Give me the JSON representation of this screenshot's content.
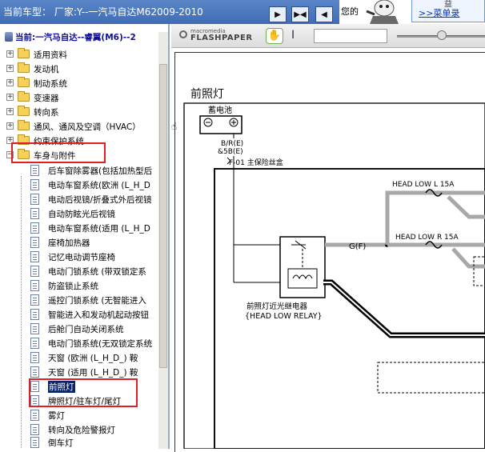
{
  "header": {
    "title": "当前车型：  厂家:Y--一汽马自达M62009-2010",
    "nav_buttons": [
      "▶",
      "▶◀",
      "◀"
    ]
  },
  "ad": {
    "message": "您的",
    "bubble_top": "益",
    "link": ">>菜单录"
  },
  "tree": {
    "current": "当前:一汽马自达--睿翼(M6)--2",
    "folders": [
      {
        "label": "适用资料"
      },
      {
        "label": "发动机"
      },
      {
        "label": "制动系统"
      },
      {
        "label": "变速器"
      },
      {
        "label": "转向系"
      },
      {
        "label": "通风、通风及空调（HVAC）"
      },
      {
        "label": "约束保护系统"
      },
      {
        "label": "车身与附件"
      }
    ],
    "leaves": [
      {
        "label": "后车窗除雾器(包括加热型后"
      },
      {
        "label": "电动车窗系统(欧洲 (L_H_D"
      },
      {
        "label": "电动后视镜/折叠式外后视镜"
      },
      {
        "label": "自动防眩光后视镜"
      },
      {
        "label": "电动车窗系统(适用 (L_H_D"
      },
      {
        "label": "座椅加热器"
      },
      {
        "label": "记忆电动调节座椅"
      },
      {
        "label": "电动门锁系统 (带双锁定系"
      },
      {
        "label": "防盗锁止系统"
      },
      {
        "label": "遥控门锁系统 (无智能进入"
      },
      {
        "label": "智能进入和发动机起动按钮"
      },
      {
        "label": "后舱门自动关闭系统"
      },
      {
        "label": "电动门锁系统(无双锁定系统"
      },
      {
        "label": "天窗    (欧洲 (L_H_D_) 鞍"
      },
      {
        "label": "天窗    (适用 (L_H_D_) 鞍"
      },
      {
        "label": "前照灯"
      },
      {
        "label": "牌照灯/驻车灯/尾灯"
      },
      {
        "label": "雾灯"
      },
      {
        "label": "转向及危险警报灯"
      },
      {
        "label": "倒车灯"
      }
    ]
  },
  "viewer": {
    "logo_small": "macromedia",
    "logo_big": "FLASHPAPER",
    "hand_tool": "hand-tool",
    "select_tool": "I"
  },
  "diagram": {
    "title": "前照灯",
    "battery": "蓄电池",
    "wire1": "B/R(E)",
    "wire2": "&5B(E)",
    "fuse": "F-01 主保险丝盒",
    "ground_label": "G(F)",
    "fuse_left": "HEAD LOW L 15A",
    "fuse_right": "HEAD LOW R 15A",
    "relay_cn": "前照灯近光继电器",
    "relay_en": "{HEAD LOW RELAY}",
    "wire_colors": {
      "thick": "#000000",
      "grey": "#a8a8a8"
    }
  }
}
